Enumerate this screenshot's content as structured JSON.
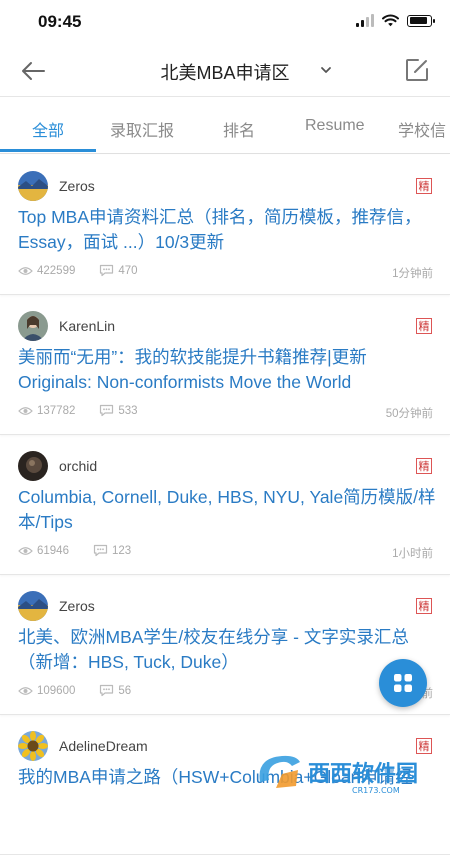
{
  "status": {
    "time": "09:45"
  },
  "nav": {
    "title": "北美MBA申请区"
  },
  "tabs": [
    "全部",
    "录取汇报",
    "排名",
    "Resume",
    "学校信"
  ],
  "posts": [
    {
      "user": "Zeros",
      "badge": "精",
      "title": "Top MBA申请资料汇总（排名，简历模板，推荐信，Essay，面试 ...）10/3更新",
      "views": "422599",
      "comments": "470",
      "time": "1分钟前"
    },
    {
      "user": "KarenLin",
      "badge": "精",
      "title": "美丽而“无用”：我的软技能提升书籍推荐|更新Originals: Non-conformists Move the World",
      "views": "137782",
      "comments": "533",
      "time": "50分钟前"
    },
    {
      "user": "orchid",
      "badge": "精",
      "title": "Columbia, Cornell, Duke, HBS, NYU, Yale简历模版/样本/Tips",
      "views": "61946",
      "comments": "123",
      "time": "1小时前"
    },
    {
      "user": "Zeros",
      "badge": "精",
      "title": "北美、欧洲MBA学生/校友在线分享 - 文字实录汇总（新增：HBS, Tuck, Duke）",
      "views": "109600",
      "comments": "56",
      "time": "前"
    },
    {
      "user": "AdelineDream",
      "badge": "精",
      "title": "我的MBA申请之路（HSW+Columbia+Gloan申请经",
      "views": "",
      "comments": "",
      "time": ""
    }
  ],
  "watermark": {
    "text": "西西软件园",
    "url": "CR173.COM"
  },
  "colors": {
    "accent": "#2a8ed8",
    "link": "#2a7bc4",
    "badge": "#c33"
  },
  "icons": [
    "back-arrow-icon",
    "chevron-down-icon",
    "edit-icon",
    "eye-icon",
    "comment-icon",
    "grid-icon"
  ]
}
